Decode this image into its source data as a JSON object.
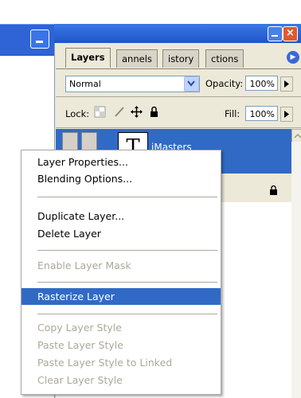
{
  "palette": {
    "tabs": [
      "Layers",
      "annels",
      "istory",
      "ctions"
    ],
    "blend_mode": "Normal",
    "opacity_label": "Opacity:",
    "opacity_value": "100%",
    "lock_label": "Lock:",
    "fill_label": "Fill:",
    "fill_value": "100%",
    "layer_name": "iMasters",
    "text_layer_glyph": "T"
  },
  "context_menu": {
    "items": [
      {
        "label": "Layer Properties...",
        "enabled": true
      },
      {
        "label": "Blending Options...",
        "enabled": true
      },
      {
        "label": "Duplicate Layer...",
        "enabled": true
      },
      {
        "label": "Delete Layer",
        "enabled": true
      },
      {
        "label": "Enable Layer Mask",
        "enabled": false
      },
      {
        "label": "Rasterize Layer",
        "enabled": true,
        "highlighted": true
      },
      {
        "label": "Copy Layer Style",
        "enabled": false
      },
      {
        "label": "Paste Layer Style",
        "enabled": false
      },
      {
        "label": "Paste Layer Style to Linked",
        "enabled": false
      },
      {
        "label": "Clear Layer Style",
        "enabled": false
      }
    ]
  },
  "colors": {
    "title_blue": "#2f64d6",
    "selection_blue": "#316ac5",
    "panel_bg": "#ece9d8",
    "disabled_text": "#aca899"
  },
  "icons": [
    "minimize-icon",
    "close-icon",
    "palette-menu-icon",
    "dropdown-arrow-icon",
    "lock-transparent-icon",
    "lock-paint-icon",
    "lock-move-icon",
    "lock-all-icon",
    "eye-icon",
    "brush-link-icon",
    "lock-indicator-icon"
  ]
}
